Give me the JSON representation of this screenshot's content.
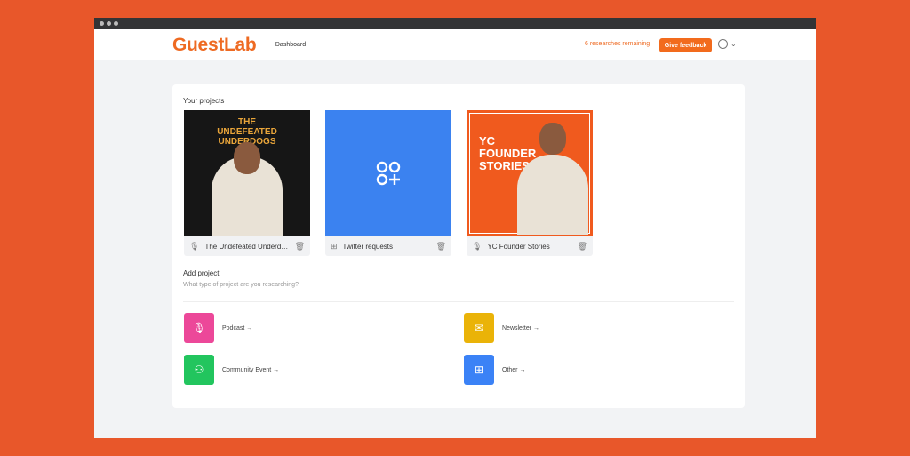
{
  "header": {
    "logo": "GuestLab",
    "tab": "Dashboard",
    "remaining": "6 researches remaining",
    "feedback": "Give feedback"
  },
  "projects": {
    "title": "Your projects",
    "items": [
      {
        "name": "The Undefeated Underdo...",
        "cover_title": "THE UNDEFEATED UNDERDOGS",
        "icon": "microphone-icon"
      },
      {
        "name": "Twitter requests",
        "icon": "apps-add-icon"
      },
      {
        "name": "YC Founder Stories",
        "cover_title": "YC FOUNDER STORIES",
        "icon": "microphone-icon"
      }
    ]
  },
  "add": {
    "title": "Add project",
    "subtitle": "What type of project are you researching?",
    "options": [
      {
        "label": "Podcast →",
        "color": "#EC4899"
      },
      {
        "label": "Newsletter →",
        "color": "#EAB308"
      },
      {
        "label": "Community Event →",
        "color": "#22C55E"
      },
      {
        "label": "Other →",
        "color": "#3B82F6"
      }
    ]
  }
}
